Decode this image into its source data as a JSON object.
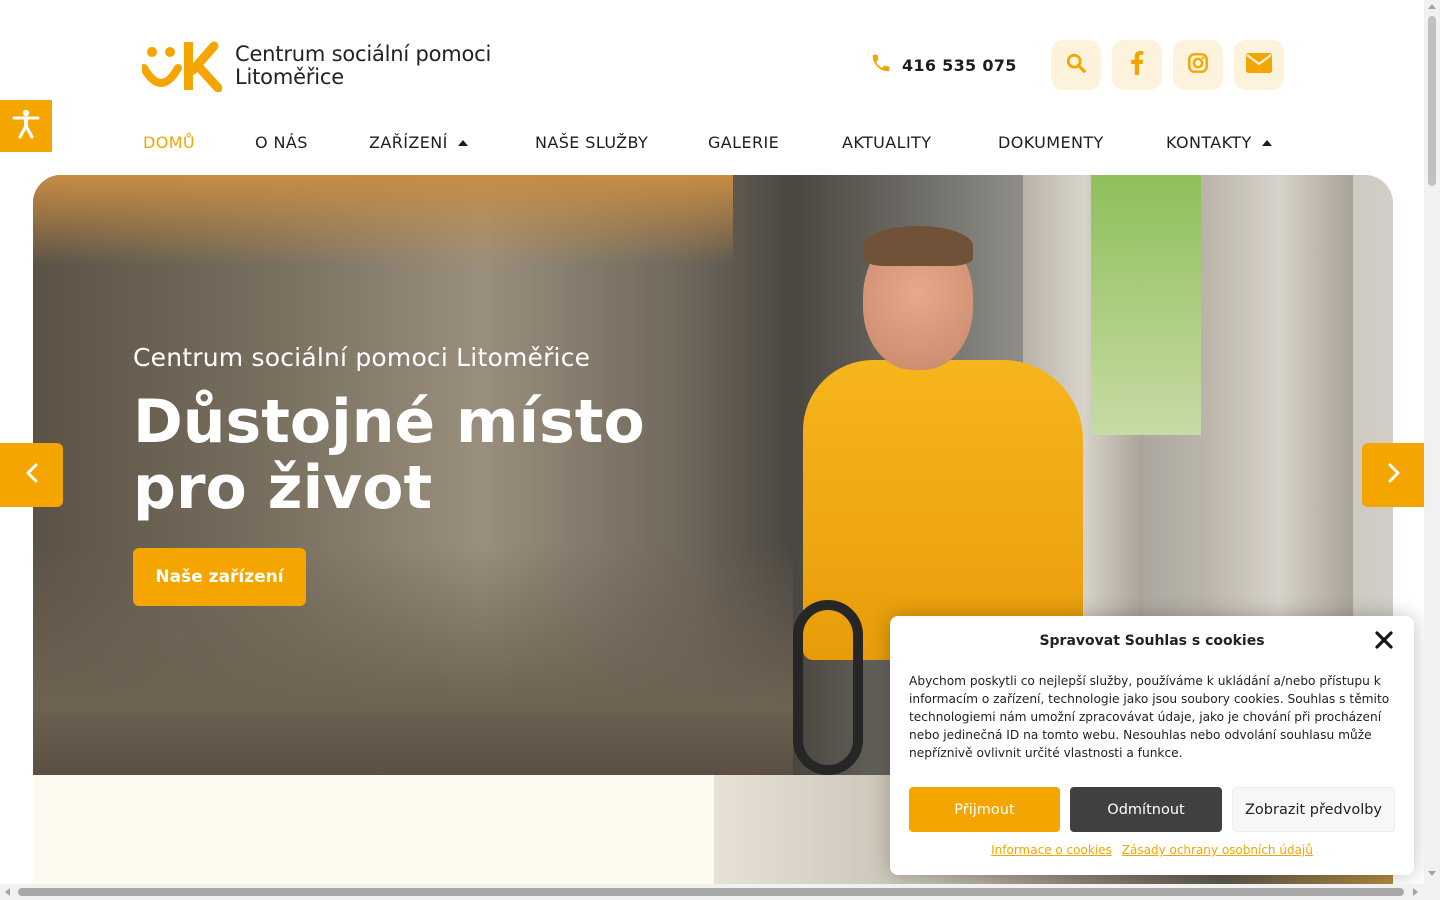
{
  "header": {
    "logo_line1": "Centrum sociální pomoci",
    "logo_line2": "Litoměřice",
    "phone": "416 535 075",
    "icons": [
      "search-icon",
      "facebook-icon",
      "instagram-icon",
      "mail-icon"
    ]
  },
  "nav": {
    "items": [
      {
        "label": "DOMŮ",
        "active": true
      },
      {
        "label": "O NÁS"
      },
      {
        "label": "ZAŘÍZENÍ",
        "dropdown": true
      },
      {
        "label": "NAŠE SLUŽBY"
      },
      {
        "label": "GALERIE"
      },
      {
        "label": "AKTUALITY"
      },
      {
        "label": "DOKUMENTY"
      },
      {
        "label": "KONTAKTY",
        "dropdown": true
      }
    ]
  },
  "hero": {
    "subtitle": "Centrum sociální pomoci Litoměřice",
    "title_line1": "Důstojné místo",
    "title_line2": "pro život",
    "button": "Naše zařízení"
  },
  "cookie": {
    "title": "Spravovat Souhlas s cookies",
    "text": "Abychom poskytli co nejlepší služby, používáme k ukládání a/nebo přístupu k informacím o zařízení, technologie jako jsou soubory cookies. Souhlas s těmito technologiemi nám umožní zpracovávat údaje, jako je chování při procházení nebo jedinečná ID na tomto webu. Nesouhlas nebo odvolání souhlasu může nepříznivě ovlivnit určité vlastnosti a funkce.",
    "accept": "Přijmout",
    "deny": "Odmítnout",
    "prefs": "Zobrazit předvolby",
    "link1": "Informace o cookies",
    "link2": "Zásady ochrany osobních údajů"
  },
  "colors": {
    "accent": "#f5a500",
    "icon_bg": "#fdf3dc",
    "deny_bg": "#404040"
  }
}
